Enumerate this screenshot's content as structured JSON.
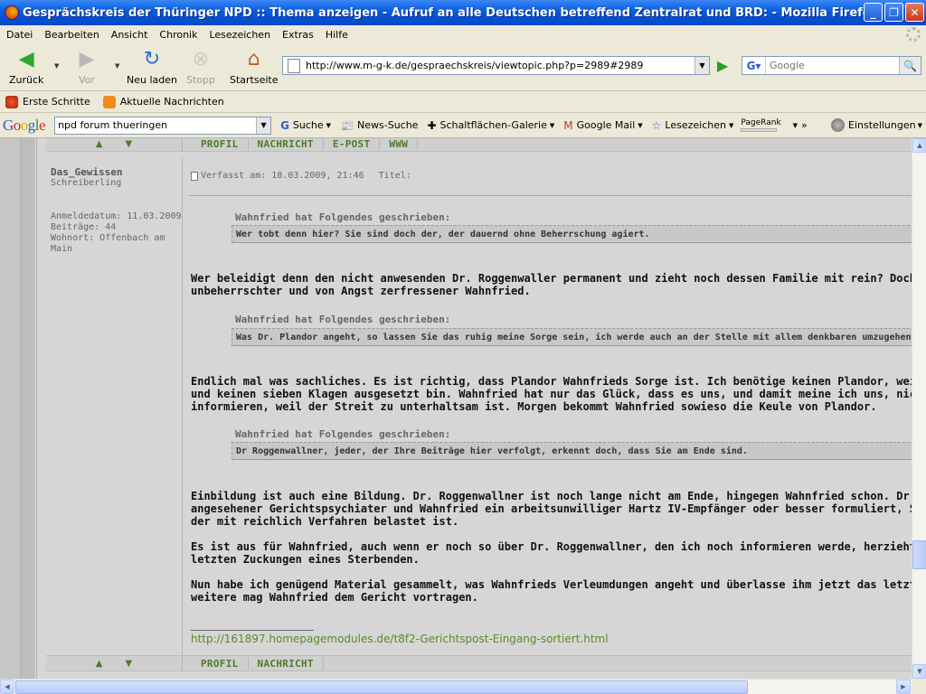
{
  "window": {
    "title": "Gesprächskreis der Thüringer NPD :: Thema anzeigen - Aufruf an alle Deutschen betreffend Zentralrat und BRD: - Mozilla Firefox"
  },
  "menu": [
    "Datei",
    "Bearbeiten",
    "Ansicht",
    "Chronik",
    "Lesezeichen",
    "Extras",
    "Hilfe"
  ],
  "nav": {
    "back": "Zurück",
    "forward": "Vor",
    "reload": "Neu laden",
    "stop": "Stopp",
    "home": "Startseite",
    "url": "http://www.m-g-k.de/gespraechskreis/viewtopic.php?p=2989#2989",
    "search_placeholder": "Google"
  },
  "bookmarks": [
    "Erste Schritte",
    "Aktuelle Nachrichten"
  ],
  "google_toolbar": {
    "logo": "Google",
    "query": "npd forum thueringen",
    "search": "Suche",
    "news": "News-Suche",
    "gallery": "Schaltflächen-Galerie",
    "mail": "Google Mail",
    "bookmarks": "Lesezeichen",
    "pagerank": "PageRank",
    "more": "»",
    "settings": "Einstellungen"
  },
  "post_links_top": [
    "PROFIL",
    "NACHRICHT",
    "E-POST",
    "WWW"
  ],
  "post_links_bottom": [
    "PROFIL",
    "NACHRICHT"
  ],
  "author": {
    "name": "Das_Gewissen",
    "rank": "Schreiberling",
    "joined": "Anmeldedatum: 11.03.2009",
    "posts": "Beiträge: 44",
    "location": "Wohnort: Offenbach am Main"
  },
  "post": {
    "header": "Verfasst am: 18.03.2009, 21:46",
    "title_label": "Titel:",
    "quote_head": "Wahnfried hat Folgendes geschrieben:",
    "quotes": [
      "Wer tobt denn hier? Sie sind doch der, der dauernd ohne Beherrschung agiert.",
      "Was Dr. Plandor angeht, so lassen Sie das ruhig meine Sorge sein, ich werde auch an der Stelle mit allem denkbaren umzugehen wiss",
      "Dr Roggenwallner, jeder, der Ihre Beiträge hier verfolgt, erkennt doch, dass Sie am Ende sind."
    ],
    "p1": [
      "Wer beleidigt denn den nicht anwesenden Dr. Roggenwaller permanent und zieht noch dessen Familie mit rein? Doch nur",
      "unbeherrschter und von Angst zerfressener Wahnfried."
    ],
    "p2": [
      "Endlich mal was sachliches. Es ist richtig, dass Plandor Wahnfrieds Sorge ist. Ich benötige keinen Plandor, weil ich rechts",
      "und keinen sieben Klagen ausgesetzt bin. Wahnfried hat nur das Glück, dass es uns, und damit meine ich uns, nicht liegt, I",
      "informieren, weil der Streit zu unterhaltsam ist. Morgen bekommt Wahnfried sowieso die Keule von Plandor."
    ],
    "p3": [
      "Einbildung ist auch eine Bildung. Dr. Roggenwallner ist noch lange nicht am Ende, hingegen Wahnfried schon. Dr. Roggenw",
      "angesehener Gerichtspsychiater und Wahnfried ein arbeitsunwilliger Hartz IV-Empfänger oder besser formuliert, Sozials",
      "der mit reichlich Verfahren belastet ist."
    ],
    "p4": [
      "Es ist aus für Wahnfried, auch wenn er noch so über Dr. Roggenwallner, den ich noch informieren werde, herzieht. Es sind",
      "letzten Zuckungen eines Sterbenden."
    ],
    "p5": [
      "Nun habe ich genügend Material gesammelt, was Wahnfrieds Verleumdungen angeht und überlasse ihm jetzt das letzte W",
      "weitere mag Wahnfried dem Gericht vortragen."
    ],
    "signature_link": "http://161897.homepagemodules.de/t8f2-Gerichtspost-Eingang-sortiert.html"
  }
}
